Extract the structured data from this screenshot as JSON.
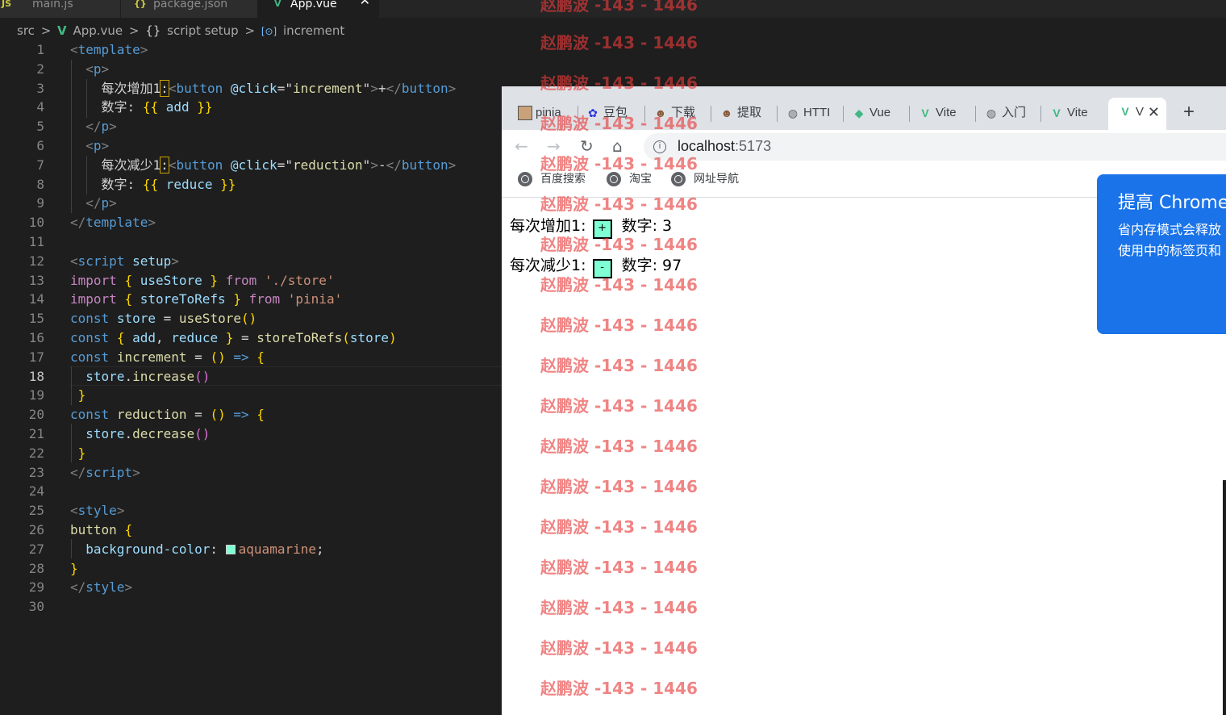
{
  "editor": {
    "tabs": [
      {
        "icon": "JS",
        "label": "main.js"
      },
      {
        "icon": "{}",
        "label": "package.json"
      },
      {
        "icon": "V",
        "label": "App.vue",
        "close": "✕"
      }
    ],
    "breadcrumb": [
      "src",
      ">",
      "App.vue",
      ">",
      "{}",
      "script setup",
      ">",
      "increment"
    ],
    "current_line": "18"
  },
  "browser": {
    "tabs": [
      "pinia",
      "豆包",
      "下载",
      "提取",
      "HTTI",
      "Vue",
      "Vite",
      "入门",
      "Vite",
      "V"
    ],
    "new_tab": "+",
    "url_host": "localhost",
    "url_port": ":5173",
    "bookmarks": [
      "百度搜索",
      "淘宝",
      "网址导航"
    ],
    "page": {
      "row1_label": "每次增加1:",
      "row1_button": "+",
      "row1_text": "数字: 3",
      "row2_label": "每次减少1:",
      "row2_button": "-",
      "row2_text": "数字: 97"
    },
    "popup": {
      "title": "提高 Chrome",
      "line1": "省内存模式会释放",
      "line2": "使用中的标签页和"
    }
  },
  "watermark": "赵鹏波 -143 - 1446"
}
